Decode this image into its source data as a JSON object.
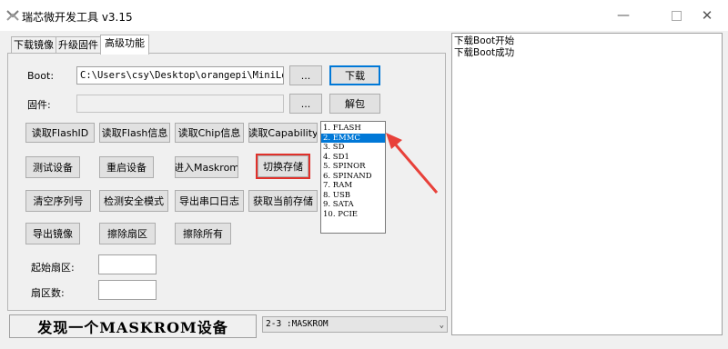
{
  "window": {
    "title": "瑞芯微开发工具 v3.15",
    "controls": [
      "minimize",
      "maximize",
      "close"
    ]
  },
  "tabs": [
    {
      "label": "下载镜像",
      "active": false
    },
    {
      "label": "升级固件",
      "active": false
    },
    {
      "label": "高级功能",
      "active": true
    }
  ],
  "boot": {
    "label": "Boot:",
    "value": "C:\\Users\\csy\\Desktop\\orangepi\\MiniLoader-烧录",
    "browse": "...",
    "action": "下载"
  },
  "firmware": {
    "label": "固件:",
    "value": "",
    "browse": "...",
    "action": "解包"
  },
  "buttons": {
    "row1": [
      "读取FlashID",
      "读取Flash信息",
      "读取Chip信息",
      "读取Capability"
    ],
    "row2": [
      "测试设备",
      "重启设备",
      "进入Maskrom",
      "切换存储"
    ],
    "row3": [
      "清空序列号",
      "检测安全模式",
      "导出串口日志",
      "获取当前存储"
    ],
    "row4": [
      "导出镜像",
      "擦除扇区",
      "擦除所有"
    ]
  },
  "storage_list": {
    "items": [
      "1. FLASH",
      "2. EMMC",
      "3. SD",
      "4. SD1",
      "5. SPINOR",
      "6. SPINAND",
      "7. RAM",
      "8. USB",
      "9. SATA",
      "10. PCIE"
    ],
    "selected_index": 1
  },
  "start_sector": {
    "label": "起始扇区:",
    "value": ""
  },
  "sector_count": {
    "label": "扇区数:",
    "value": ""
  },
  "log": {
    "lines": [
      "下载Boot开始",
      "下载Boot成功"
    ]
  },
  "status": {
    "text": "发现一个MASKROM设备"
  },
  "device_combo": {
    "value": "2-3 :MASKROM"
  },
  "colors": {
    "selection": "#0078d7",
    "highlight_box": "#e0312b",
    "annotation_arrow": "#e8413a"
  }
}
